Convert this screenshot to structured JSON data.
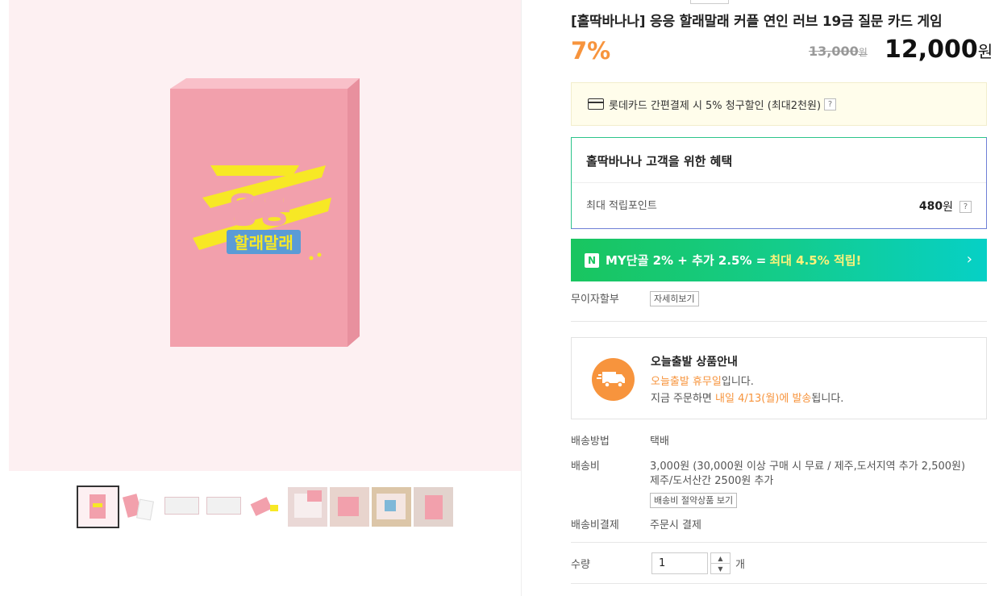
{
  "product": {
    "title": "[홀딱바나나] 응응 할래말래 커플 연인 러브 19금 질문 카드 게임",
    "discount_rate": "7%",
    "original_price": "13,000",
    "original_price_unit": "원",
    "final_price": "12,000",
    "final_price_unit": "원",
    "box_logo_line1": "응응",
    "box_logo_line2": "할래말래"
  },
  "card_promo": {
    "text": "롯데카드 간편결제 시 5% 청구할인 (최대2천원)",
    "help": "?"
  },
  "benefit": {
    "title": "홀딱바나나 고객을 위한 혜택",
    "label": "최대 적립포인트",
    "value": "480",
    "unit": "원",
    "help": "?"
  },
  "naver": {
    "logo": "N",
    "text": "MY단골 2% + 추가 2.5% =",
    "highlight": "최대 4.5% 적립!",
    "chevron": "›"
  },
  "installment": {
    "label": "무이자할부",
    "button": "자세히보기"
  },
  "today_shipping": {
    "title": "오늘출발 상품안내",
    "line1_hl": "오늘출발 휴무일",
    "line1_rest": "입니다.",
    "line2_pre": "지금 주문하면 ",
    "line2_hl": "내일 4/13(월)에 발송",
    "line2_post": "됩니다."
  },
  "delivery": {
    "method_label": "배송방법",
    "method_value": "택배",
    "fee_label": "배송비",
    "fee_line1": "3,000원 (30,000원 이상 구매 시 무료 / 제주,도서지역 추가 2,500원)",
    "fee_line2": "제주/도서산간 2500원 추가",
    "fee_button": "배송비 절약상품 보기",
    "payment_label": "배송비결제",
    "payment_value": "주문시 결제"
  },
  "quantity": {
    "label": "수량",
    "value": "1",
    "unit": "개",
    "up": "▲",
    "down": "▼"
  },
  "colors": {
    "accent_orange": "#f7943d",
    "naver_green": "#19c55f",
    "naver_teal": "#06d0c6",
    "box_pink": "#f2a0ac",
    "logo_yellow": "#f7e825"
  }
}
